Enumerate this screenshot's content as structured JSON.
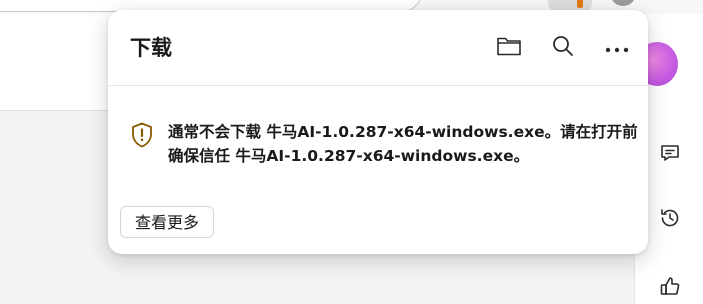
{
  "popup": {
    "title": "下载",
    "tools": [
      {
        "name": "open-folder",
        "icon": "folder-icon"
      },
      {
        "name": "search",
        "icon": "search-icon"
      },
      {
        "name": "more-options",
        "icon": "more-horizontal-icon"
      }
    ],
    "warning": {
      "icon": "shield-warning-icon",
      "message": "通常不会下载 牛马AI-1.0.287-x64-windows.exe。请在打开前确保信任 牛马AI-1.0.287-x64-windows.exe。"
    },
    "more_button_label": "查看更多"
  },
  "sidebar": {
    "icons": [
      "avatar",
      "feedback-icon",
      "history-icon",
      "thumbs-up-icon"
    ]
  },
  "colors": {
    "warning_icon": "#8a5a00",
    "download_glyph": "#e07a14",
    "avatar_gradient_start": "#f08ae6",
    "avatar_gradient_end": "#a844d6"
  }
}
